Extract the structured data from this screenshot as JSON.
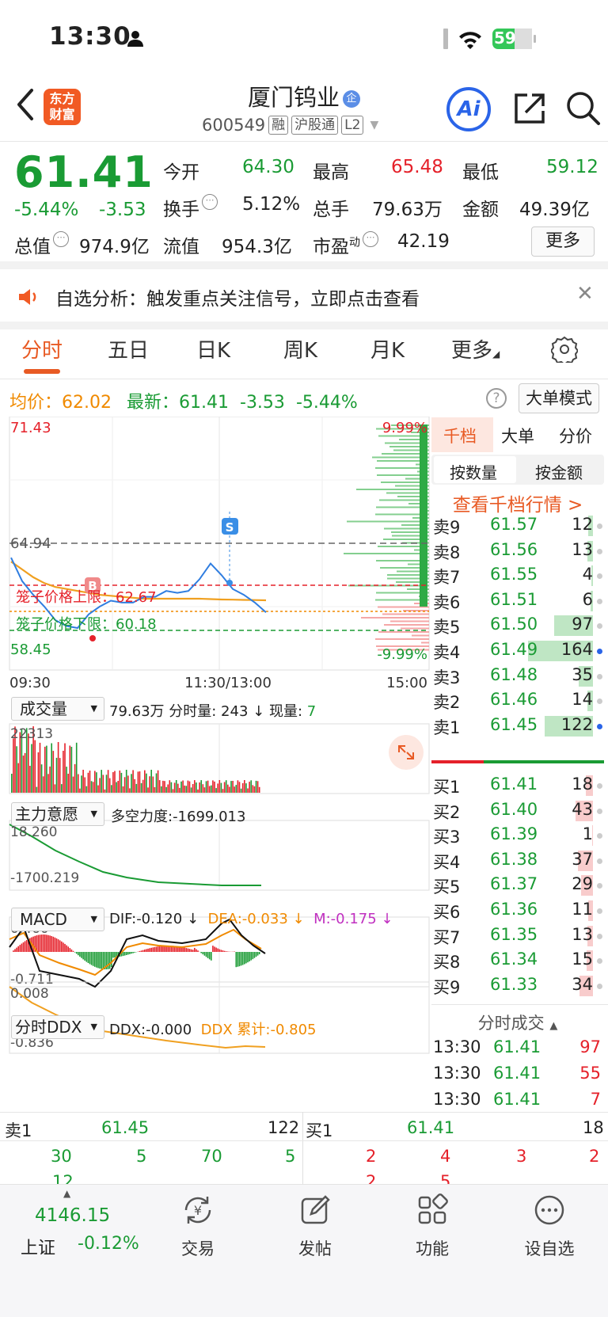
{
  "status": {
    "time": "13:30",
    "battery": "59"
  },
  "header": {
    "logo_line1": "东方",
    "logo_line2": "财富",
    "name": "厦门钨业",
    "qi": "企",
    "code": "600549",
    "tags": [
      "融",
      "沪股通",
      "L2"
    ],
    "ai": "Ai"
  },
  "quote": {
    "price": "61.41",
    "pct": "-5.44%",
    "chg": "-3.53",
    "fields": [
      {
        "l": "今开",
        "v": "64.30"
      },
      {
        "l": "最高",
        "v": "65.48"
      },
      {
        "l": "最低",
        "v": "59.12"
      },
      {
        "l": "换手",
        "v": "5.12%"
      },
      {
        "l": "总手",
        "v": "79.63万"
      },
      {
        "l": "金额",
        "v": "49.39亿"
      },
      {
        "l": "总值",
        "v": "974.9亿"
      },
      {
        "l": "流值",
        "v": "954.3亿"
      },
      {
        "l": "市盈",
        "v": "42.19",
        "sup": "动"
      }
    ],
    "more": "更多"
  },
  "banner": {
    "text": "自选分析：触发重点关注信号，立即点击查看"
  },
  "tabs": [
    "分时",
    "五日",
    "日K",
    "周K",
    "月K",
    "更多"
  ],
  "infoline": {
    "avg_label": "均价：",
    "avg": "62.02",
    "last_label": "最新：",
    "last": "61.41",
    "chg": "-3.53",
    "pct": "-5.44%",
    "mode": "大单模式"
  },
  "chart": {
    "y_top": "71.43",
    "y_bottom": "58.45",
    "pct_top": "9.99%",
    "pct_bottom": "-9.99%",
    "prev_close": "64.94",
    "upper_limit_label": "笼子价格上限：62.67",
    "lower_limit_label": "笼子价格下限：60.18",
    "x_labels": [
      "09:30",
      "11:30/13:00",
      "15:00"
    ],
    "s_marker": "S",
    "b_marker": "B",
    "vol_menu": "成交量",
    "vol_total": "79.63万",
    "vol_detail": "分时量: 243",
    "vol_now_label": "现量:",
    "vol_now": "7",
    "vol_max": "22313",
    "main_menu": "主力意愿",
    "main_label": "多空力度:-1699.013",
    "main_top": "18.260",
    "main_bottom": "-1700.219",
    "macd_menu": "MACD",
    "dif": "DIF:-0.120",
    "dea": "DEA:-0.033",
    "m": "M:-0.175",
    "macd_top": "0.460",
    "macd_bottom": "-0.711",
    "ddx_menu": "分时DDX",
    "ddx": "DDX:-0.000",
    "ddx_sum": "DDX 累计:-0.805",
    "ddx_top": "0.008",
    "ddx_bottom": "-0.836"
  },
  "chart_data": {
    "type": "line",
    "series": [
      {
        "name": "最新",
        "values": [
          64.2,
          63.0,
          62.3,
          61.7,
          61.0,
          60.7,
          60.6,
          61.3,
          61.7,
          62.0,
          61.9,
          61.9,
          62.2,
          62.2,
          62.5,
          62.4,
          62.5,
          63.1,
          63.9,
          63.3,
          62.6,
          62.3,
          61.9,
          61.4
        ]
      },
      {
        "name": "均价",
        "values": [
          64.0,
          63.6,
          63.2,
          62.9,
          62.7,
          62.6,
          62.5,
          62.4,
          62.3,
          62.25,
          62.2,
          62.15,
          62.1,
          62.1,
          62.1,
          62.1,
          62.1,
          62.1,
          62.08,
          62.06,
          62.05,
          62.04,
          62.03,
          62.02
        ]
      }
    ],
    "ylim": [
      58.45,
      71.43
    ]
  },
  "orderbook": {
    "tabs": [
      "千档",
      "大单",
      "分价"
    ],
    "seg": [
      "按数量",
      "按金额"
    ],
    "view": "查看千档行情 >",
    "asks": [
      {
        "n": "卖9",
        "p": "61.57",
        "v": "12"
      },
      {
        "n": "卖8",
        "p": "61.56",
        "v": "13"
      },
      {
        "n": "卖7",
        "p": "61.55",
        "v": "4"
      },
      {
        "n": "卖6",
        "p": "61.51",
        "v": "6"
      },
      {
        "n": "卖5",
        "p": "61.50",
        "v": "97"
      },
      {
        "n": "卖4",
        "p": "61.49",
        "v": "164"
      },
      {
        "n": "卖3",
        "p": "61.48",
        "v": "35"
      },
      {
        "n": "卖2",
        "p": "61.46",
        "v": "14"
      },
      {
        "n": "卖1",
        "p": "61.45",
        "v": "122"
      }
    ],
    "bids": [
      {
        "n": "买1",
        "p": "61.41",
        "v": "18"
      },
      {
        "n": "买2",
        "p": "61.40",
        "v": "43"
      },
      {
        "n": "买3",
        "p": "61.39",
        "v": "1"
      },
      {
        "n": "买4",
        "p": "61.38",
        "v": "37"
      },
      {
        "n": "买5",
        "p": "61.37",
        "v": "29"
      },
      {
        "n": "买6",
        "p": "61.36",
        "v": "11"
      },
      {
        "n": "买7",
        "p": "61.35",
        "v": "13"
      },
      {
        "n": "买8",
        "p": "61.34",
        "v": "15"
      },
      {
        "n": "买9",
        "p": "61.33",
        "v": "34"
      }
    ],
    "tick_head": "分时成交",
    "ticks": [
      {
        "t": "13:30",
        "p": "61.41",
        "v": "97"
      },
      {
        "t": "13:30",
        "p": "61.41",
        "v": "55"
      },
      {
        "t": "13:30",
        "p": "61.41",
        "v": "7"
      }
    ]
  },
  "l2": {
    "sell_label": "卖1",
    "sell_price": "61.45",
    "sell_vol": "122",
    "sell_queue": [
      "30",
      "5",
      "70",
      "5",
      "12"
    ],
    "buy_label": "买1",
    "buy_price": "61.41",
    "buy_vol": "18",
    "buy_queue": [
      "2",
      "4",
      "3",
      "2",
      "2",
      "5"
    ]
  },
  "nav": {
    "index_value": "4146.15",
    "index_name": "上证",
    "index_pct": "-0.12%",
    "items": [
      "交易",
      "发帖",
      "功能",
      "设自选"
    ]
  }
}
